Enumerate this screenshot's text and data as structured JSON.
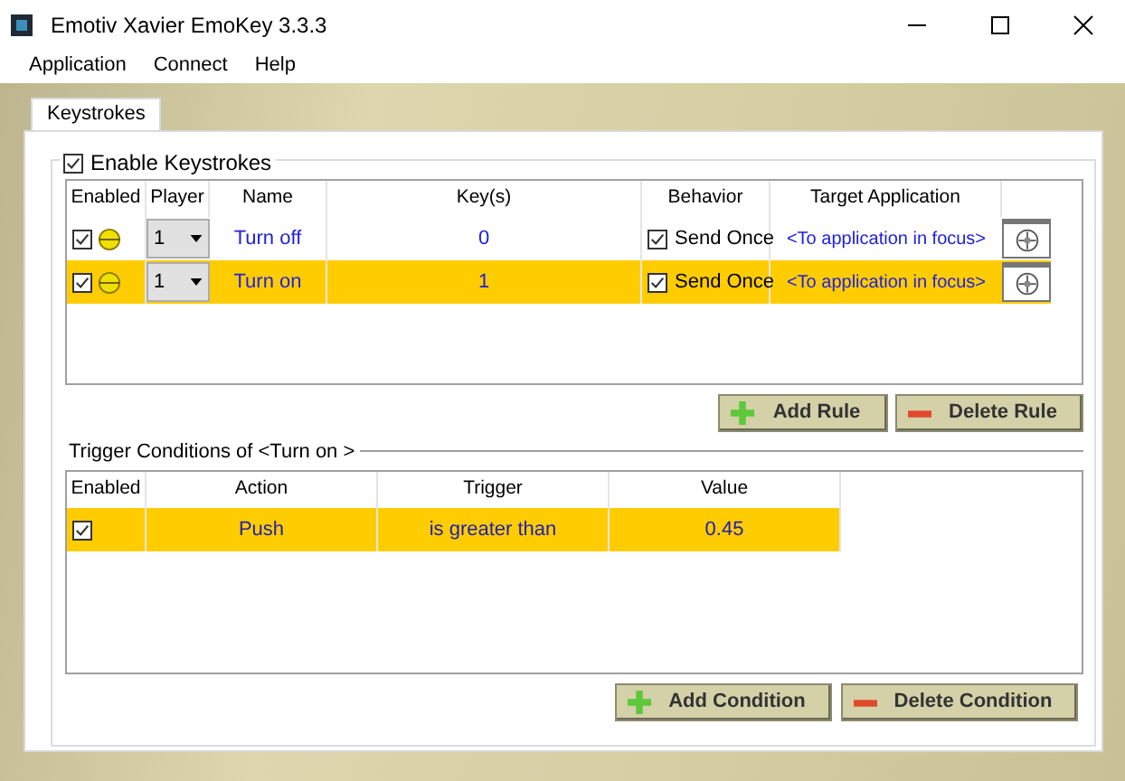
{
  "window": {
    "title": "Emotiv Xavier EmoKey 3.3.3"
  },
  "menu": [
    "Application",
    "Connect",
    "Help"
  ],
  "tabs": [
    {
      "label": "Keystrokes",
      "selected": true
    }
  ],
  "enable_keystrokes": {
    "label": "Enable Keystrokes",
    "checked": true
  },
  "rules": {
    "columns": [
      "Enabled",
      "Player",
      "Name",
      "Key(s)",
      "Behavior",
      "Target Application"
    ],
    "rows": [
      {
        "enabled": true,
        "player": "1",
        "name": "Turn off",
        "keys": "0",
        "send_once": true,
        "behavior": "Send Once",
        "target": "<To application in focus>",
        "selected": false
      },
      {
        "enabled": true,
        "player": "1",
        "name": "Turn on",
        "keys": "1",
        "send_once": true,
        "behavior": "Send Once",
        "target": "<To application in focus>",
        "selected": true
      }
    ]
  },
  "rule_buttons": [
    {
      "label": "Add Rule",
      "kind": "add"
    },
    {
      "label": "Delete Rule",
      "kind": "delete"
    }
  ],
  "conditions": {
    "title": "Trigger Conditions of <Turn on >",
    "columns": [
      "Enabled",
      "Action",
      "Trigger",
      "Value"
    ],
    "rows": [
      {
        "enabled": true,
        "action": "Push",
        "trigger": "is greater than",
        "value": "0.45",
        "selected": true
      }
    ]
  },
  "condition_buttons": [
    {
      "label": "Add Condition",
      "kind": "add"
    },
    {
      "label": "Delete Condition",
      "kind": "delete"
    }
  ]
}
